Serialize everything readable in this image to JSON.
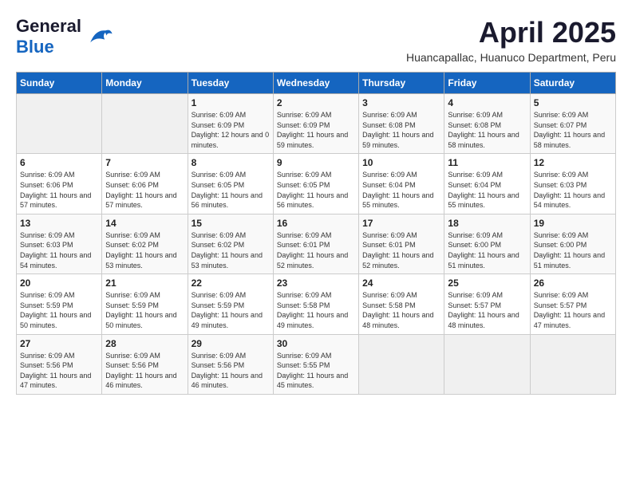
{
  "logo": {
    "general": "General",
    "blue": "Blue"
  },
  "title": "April 2025",
  "location": "Huancapallac, Huanuco Department, Peru",
  "days_of_week": [
    "Sunday",
    "Monday",
    "Tuesday",
    "Wednesday",
    "Thursday",
    "Friday",
    "Saturday"
  ],
  "weeks": [
    [
      {
        "day": null
      },
      {
        "day": null
      },
      {
        "day": 1,
        "sunrise": "6:09 AM",
        "sunset": "6:09 PM",
        "daylight": "12 hours and 0 minutes."
      },
      {
        "day": 2,
        "sunrise": "6:09 AM",
        "sunset": "6:09 PM",
        "daylight": "11 hours and 59 minutes."
      },
      {
        "day": 3,
        "sunrise": "6:09 AM",
        "sunset": "6:08 PM",
        "daylight": "11 hours and 59 minutes."
      },
      {
        "day": 4,
        "sunrise": "6:09 AM",
        "sunset": "6:08 PM",
        "daylight": "11 hours and 58 minutes."
      },
      {
        "day": 5,
        "sunrise": "6:09 AM",
        "sunset": "6:07 PM",
        "daylight": "11 hours and 58 minutes."
      }
    ],
    [
      {
        "day": 6,
        "sunrise": "6:09 AM",
        "sunset": "6:06 PM",
        "daylight": "11 hours and 57 minutes."
      },
      {
        "day": 7,
        "sunrise": "6:09 AM",
        "sunset": "6:06 PM",
        "daylight": "11 hours and 57 minutes."
      },
      {
        "day": 8,
        "sunrise": "6:09 AM",
        "sunset": "6:05 PM",
        "daylight": "11 hours and 56 minutes."
      },
      {
        "day": 9,
        "sunrise": "6:09 AM",
        "sunset": "6:05 PM",
        "daylight": "11 hours and 56 minutes."
      },
      {
        "day": 10,
        "sunrise": "6:09 AM",
        "sunset": "6:04 PM",
        "daylight": "11 hours and 55 minutes."
      },
      {
        "day": 11,
        "sunrise": "6:09 AM",
        "sunset": "6:04 PM",
        "daylight": "11 hours and 55 minutes."
      },
      {
        "day": 12,
        "sunrise": "6:09 AM",
        "sunset": "6:03 PM",
        "daylight": "11 hours and 54 minutes."
      }
    ],
    [
      {
        "day": 13,
        "sunrise": "6:09 AM",
        "sunset": "6:03 PM",
        "daylight": "11 hours and 54 minutes."
      },
      {
        "day": 14,
        "sunrise": "6:09 AM",
        "sunset": "6:02 PM",
        "daylight": "11 hours and 53 minutes."
      },
      {
        "day": 15,
        "sunrise": "6:09 AM",
        "sunset": "6:02 PM",
        "daylight": "11 hours and 53 minutes."
      },
      {
        "day": 16,
        "sunrise": "6:09 AM",
        "sunset": "6:01 PM",
        "daylight": "11 hours and 52 minutes."
      },
      {
        "day": 17,
        "sunrise": "6:09 AM",
        "sunset": "6:01 PM",
        "daylight": "11 hours and 52 minutes."
      },
      {
        "day": 18,
        "sunrise": "6:09 AM",
        "sunset": "6:00 PM",
        "daylight": "11 hours and 51 minutes."
      },
      {
        "day": 19,
        "sunrise": "6:09 AM",
        "sunset": "6:00 PM",
        "daylight": "11 hours and 51 minutes."
      }
    ],
    [
      {
        "day": 20,
        "sunrise": "6:09 AM",
        "sunset": "5:59 PM",
        "daylight": "11 hours and 50 minutes."
      },
      {
        "day": 21,
        "sunrise": "6:09 AM",
        "sunset": "5:59 PM",
        "daylight": "11 hours and 50 minutes."
      },
      {
        "day": 22,
        "sunrise": "6:09 AM",
        "sunset": "5:59 PM",
        "daylight": "11 hours and 49 minutes."
      },
      {
        "day": 23,
        "sunrise": "6:09 AM",
        "sunset": "5:58 PM",
        "daylight": "11 hours and 49 minutes."
      },
      {
        "day": 24,
        "sunrise": "6:09 AM",
        "sunset": "5:58 PM",
        "daylight": "11 hours and 48 minutes."
      },
      {
        "day": 25,
        "sunrise": "6:09 AM",
        "sunset": "5:57 PM",
        "daylight": "11 hours and 48 minutes."
      },
      {
        "day": 26,
        "sunrise": "6:09 AM",
        "sunset": "5:57 PM",
        "daylight": "11 hours and 47 minutes."
      }
    ],
    [
      {
        "day": 27,
        "sunrise": "6:09 AM",
        "sunset": "5:56 PM",
        "daylight": "11 hours and 47 minutes."
      },
      {
        "day": 28,
        "sunrise": "6:09 AM",
        "sunset": "5:56 PM",
        "daylight": "11 hours and 46 minutes."
      },
      {
        "day": 29,
        "sunrise": "6:09 AM",
        "sunset": "5:56 PM",
        "daylight": "11 hours and 46 minutes."
      },
      {
        "day": 30,
        "sunrise": "6:09 AM",
        "sunset": "5:55 PM",
        "daylight": "11 hours and 45 minutes."
      },
      {
        "day": null
      },
      {
        "day": null
      },
      {
        "day": null
      }
    ]
  ]
}
